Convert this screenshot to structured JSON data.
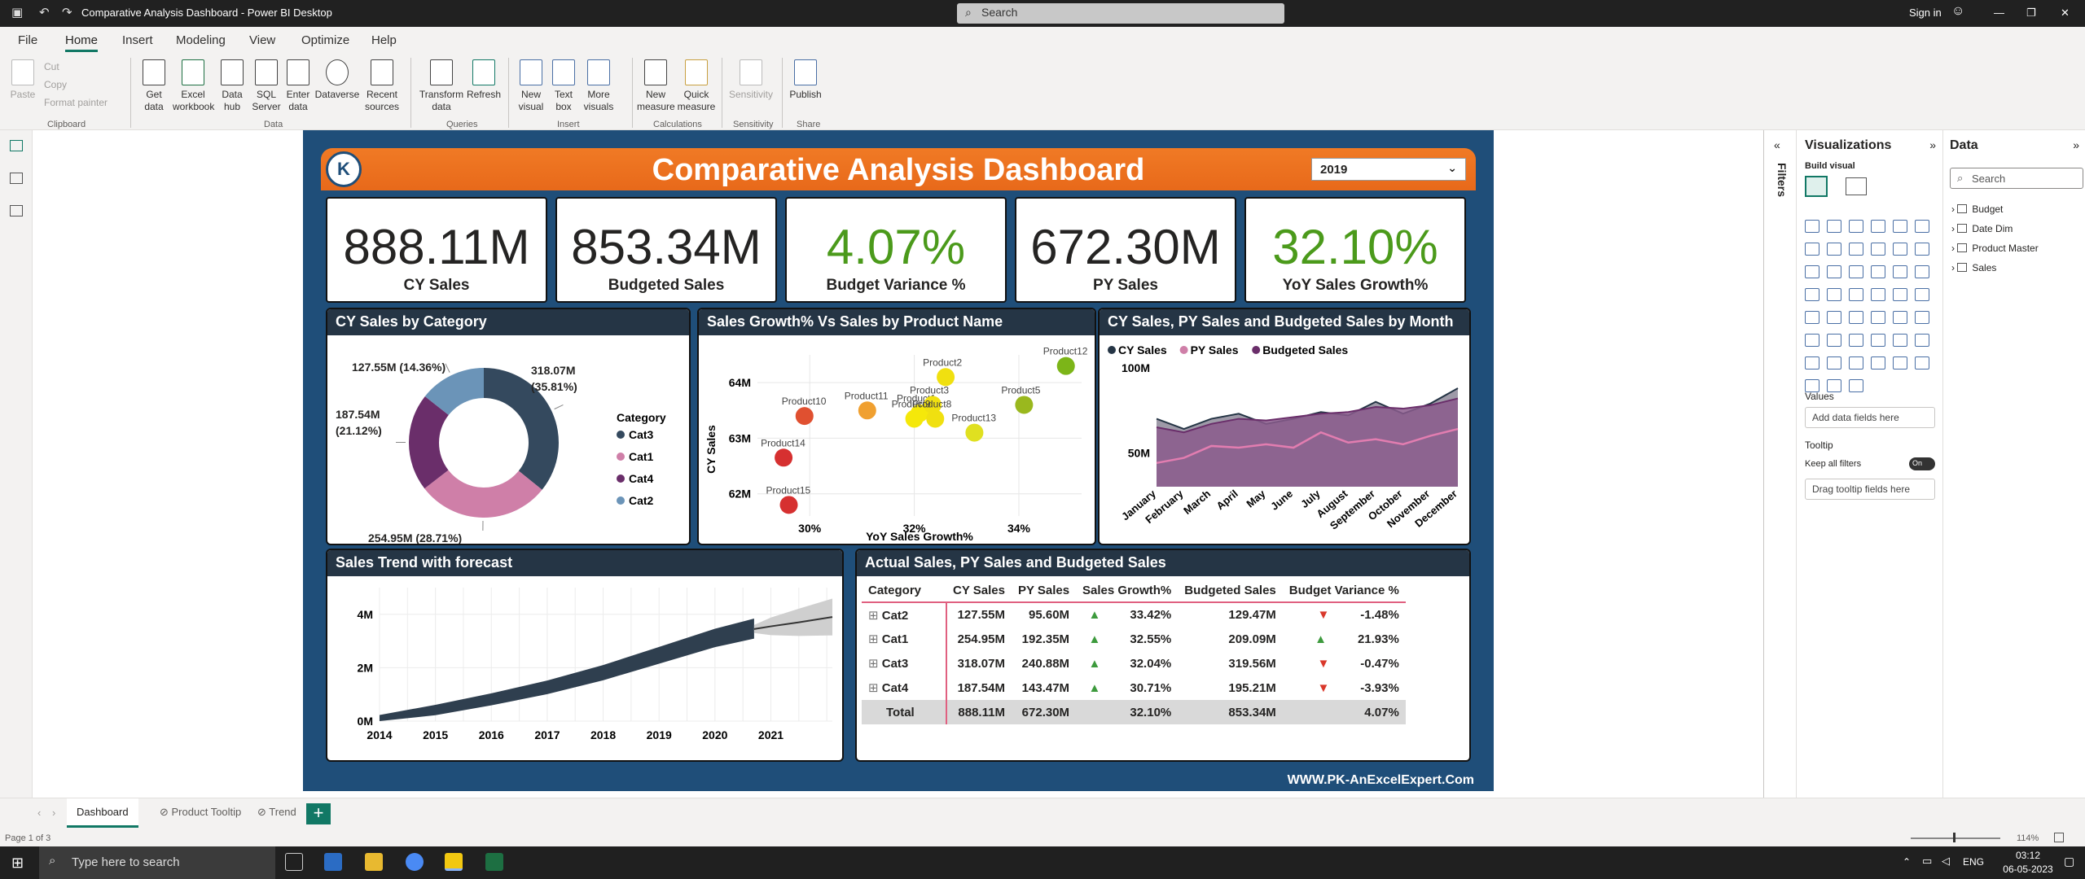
{
  "window": {
    "title": "Comparative Analysis Dashboard - Power BI Desktop",
    "search_placeholder": "Search",
    "sign_in": "Sign in"
  },
  "menu_tabs": [
    "File",
    "Home",
    "Insert",
    "Modeling",
    "View",
    "Optimize",
    "Help"
  ],
  "ribbon": {
    "clipboard": {
      "paste": "Paste",
      "cut": "Cut",
      "copy": "Copy",
      "format_painter": "Format painter",
      "group": "Clipboard"
    },
    "data": {
      "get_data": "Get data",
      "excel": "Excel workbook",
      "hub": "Data hub",
      "sql": "SQL Server",
      "enter": "Enter data",
      "dataverse": "Dataverse",
      "recent": "Recent sources",
      "group": "Data"
    },
    "queries": {
      "transform": "Transform data",
      "refresh": "Refresh",
      "group": "Queries"
    },
    "insert": {
      "new_visual": "New visual",
      "text_box": "Text box",
      "more_visuals": "More visuals",
      "group": "Insert"
    },
    "calculations": {
      "new_measure": "New measure",
      "quick_measure": "Quick measure",
      "group": "Calculations"
    },
    "sensitivity": {
      "label": "Sensitivity",
      "group": "Sensitivity"
    },
    "share": {
      "publish": "Publish",
      "group": "Share"
    }
  },
  "dashboard": {
    "title": "Comparative Analysis Dashboard",
    "logo_text": "K",
    "year": "2019",
    "footer": "WWW.PK-AnExcelExpert.Com",
    "kpis": [
      {
        "value": "888.11M",
        "label": "CY Sales",
        "color": "#252423"
      },
      {
        "value": "853.34M",
        "label": "Budgeted Sales",
        "color": "#252423"
      },
      {
        "value": "4.07%",
        "label": "Budget Variance %",
        "color": "#4b9a1b"
      },
      {
        "value": "672.30M",
        "label": "PY Sales",
        "color": "#252423"
      },
      {
        "value": "32.10%",
        "label": "YoY Sales Growth%",
        "color": "#4b9a1b"
      }
    ],
    "donut_title": "CY Sales by Category",
    "donut_legend_title": "Category",
    "donut_slices": [
      {
        "name": "Cat3",
        "label_value": "318.07M",
        "label_pct": "(35.81%)",
        "value": 318.07,
        "color": "#34495e"
      },
      {
        "name": "Cat1",
        "label_value": "254.95M (28.71%)",
        "label_pct": "",
        "value": 254.95,
        "color": "#cf7fa8"
      },
      {
        "name": "Cat4",
        "label_value": "187.54M",
        "label_pct": "(21.12%)",
        "value": 187.54,
        "color": "#6a2e6a"
      },
      {
        "name": "Cat2",
        "label_value": "127.55M (14.36%)",
        "label_pct": "",
        "value": 127.55,
        "color": "#6b94b8"
      }
    ],
    "scatter_title": "Sales Growth% Vs Sales by Product Name",
    "trend_title": "Sales Trend with forecast",
    "month_title": "CY Sales, PY Sales and Budgeted Sales by Month",
    "table_title": "Actual Sales, PY Sales and Budgeted Sales"
  },
  "chart_data": [
    {
      "type": "pie",
      "title": "CY Sales by Category",
      "categories": [
        "Cat3",
        "Cat1",
        "Cat4",
        "Cat2"
      ],
      "values": [
        318.07,
        254.95,
        187.54,
        127.55
      ],
      "unit": "M"
    },
    {
      "type": "scatter",
      "title": "Sales Growth% Vs Sales by Product Name",
      "xlabel": "YoY Sales Growth%",
      "ylabel": "CY Sales",
      "x_ticks": [
        "30%",
        "32%",
        "34%"
      ],
      "y_ticks": [
        "62M",
        "63M",
        "64M"
      ],
      "xlim": [
        29.0,
        35.2
      ],
      "ylim": [
        61.6,
        64.5
      ],
      "points": [
        {
          "name": "Product2",
          "x": 32.6,
          "y": 64.1,
          "color": "#f0e010"
        },
        {
          "name": "Product12",
          "x": 34.9,
          "y": 64.3,
          "color": "#7cb518"
        },
        {
          "name": "Product11",
          "x": 31.1,
          "y": 63.5,
          "color": "#f0a030"
        },
        {
          "name": "Product1",
          "x": 32.1,
          "y": 63.45,
          "color": "#f5e80a"
        },
        {
          "name": "Product3",
          "x": 32.35,
          "y": 63.6,
          "color": "#f0e010"
        },
        {
          "name": "Product8",
          "x": 32.4,
          "y": 63.35,
          "color": "#f0e010"
        },
        {
          "name": "Product5",
          "x": 34.1,
          "y": 63.6,
          "color": "#9ab81e"
        },
        {
          "name": "Product9",
          "x": 32.0,
          "y": 63.35,
          "color": "#f5e80a"
        },
        {
          "name": "Product10",
          "x": 29.9,
          "y": 63.4,
          "color": "#e05030"
        },
        {
          "name": "Product13",
          "x": 33.15,
          "y": 63.1,
          "color": "#e0e020"
        },
        {
          "name": "Product14",
          "x": 29.5,
          "y": 62.65,
          "color": "#d63030"
        },
        {
          "name": "Product15",
          "x": 29.6,
          "y": 61.8,
          "color": "#d63030"
        }
      ]
    },
    {
      "type": "line",
      "title": "Sales Trend with forecast",
      "x_ticks": [
        "2014",
        "2015",
        "2016",
        "2017",
        "2018",
        "2019",
        "2020",
        "2021"
      ],
      "y_ticks": [
        "0M",
        "2M",
        "4M"
      ],
      "ylim": [
        0,
        5
      ],
      "xlim": [
        2014,
        2022.1
      ],
      "series": [
        {
          "x": [
            2014,
            2015,
            2016,
            2017,
            2018,
            2019,
            2020,
            2020.7
          ],
          "values": [
            0.05,
            0.4,
            0.8,
            1.25,
            1.8,
            2.45,
            3.1,
            3.45
          ]
        },
        {
          "x": [
            2020.7,
            2021,
            2021.5,
            2022.1
          ],
          "values": [
            3.45,
            3.55,
            3.7,
            3.9
          ]
        }
      ]
    },
    {
      "type": "area",
      "title": "CY Sales, PY Sales and Budgeted Sales by Month",
      "categories": [
        "January",
        "February",
        "March",
        "April",
        "May",
        "June",
        "July",
        "August",
        "September",
        "October",
        "November",
        "December"
      ],
      "y_ticks": [
        "50M",
        "100M"
      ],
      "ylim": [
        30,
        100
      ],
      "series": [
        {
          "name": "CY Sales",
          "color": "#253545",
          "values": [
            70,
            64,
            70,
            73,
            67,
            70,
            74,
            72,
            80,
            73,
            79,
            88
          ]
        },
        {
          "name": "PY Sales",
          "color": "#cf7fa8",
          "values": [
            44,
            47,
            54,
            53,
            55,
            53,
            62,
            56,
            58,
            55,
            60,
            64
          ]
        },
        {
          "name": "Budgeted Sales",
          "color": "#6a2e6a",
          "values": [
            65,
            62,
            67,
            70,
            69,
            71,
            73,
            74,
            77,
            76,
            78,
            82
          ]
        }
      ]
    },
    {
      "type": "table",
      "title": "Actual Sales, PY Sales and Budgeted Sales",
      "columns": [
        "Category",
        "CY Sales",
        "PY Sales",
        "Sales Growth%",
        "Budgeted Sales",
        "Budget Variance %"
      ],
      "rows": [
        [
          "Cat2",
          "127.55M",
          "95.60M",
          "33.42%",
          "129.47M",
          "-1.48%"
        ],
        [
          "Cat1",
          "254.95M",
          "192.35M",
          "32.55%",
          "209.09M",
          "21.93%"
        ],
        [
          "Cat3",
          "318.07M",
          "240.88M",
          "32.04%",
          "319.56M",
          "-0.47%"
        ],
        [
          "Cat4",
          "187.54M",
          "143.47M",
          "30.71%",
          "195.21M",
          "-3.93%"
        ],
        [
          "Total",
          "888.11M",
          "672.30M",
          "32.10%",
          "853.34M",
          "4.07%"
        ]
      ],
      "growth_dir": [
        "up",
        "up",
        "up",
        "up"
      ],
      "variance_dir": [
        "down",
        "up",
        "down",
        "down"
      ]
    }
  ],
  "panes": {
    "filters": "Filters",
    "visualizations": "Visualizations",
    "build_visual": "Build visual",
    "values_label": "Values",
    "values_well": "Add data fields here",
    "tooltip_label": "Tooltip",
    "keep_filters": "Keep all filters",
    "toggle": "On",
    "tooltip_well": "Drag tooltip fields here",
    "data": "Data",
    "data_search": "Search",
    "tables": [
      "Budget",
      "Date Dim",
      "Product Master",
      "Sales"
    ]
  },
  "pages": [
    "Dashboard",
    "Product Tooltip",
    "Trend"
  ],
  "status": {
    "page": "Page 1 of 3",
    "zoom": "114%"
  },
  "taskbar": {
    "search": "Type here to search",
    "lang": "ENG",
    "time": "03:12",
    "date": "06-05-2023"
  }
}
